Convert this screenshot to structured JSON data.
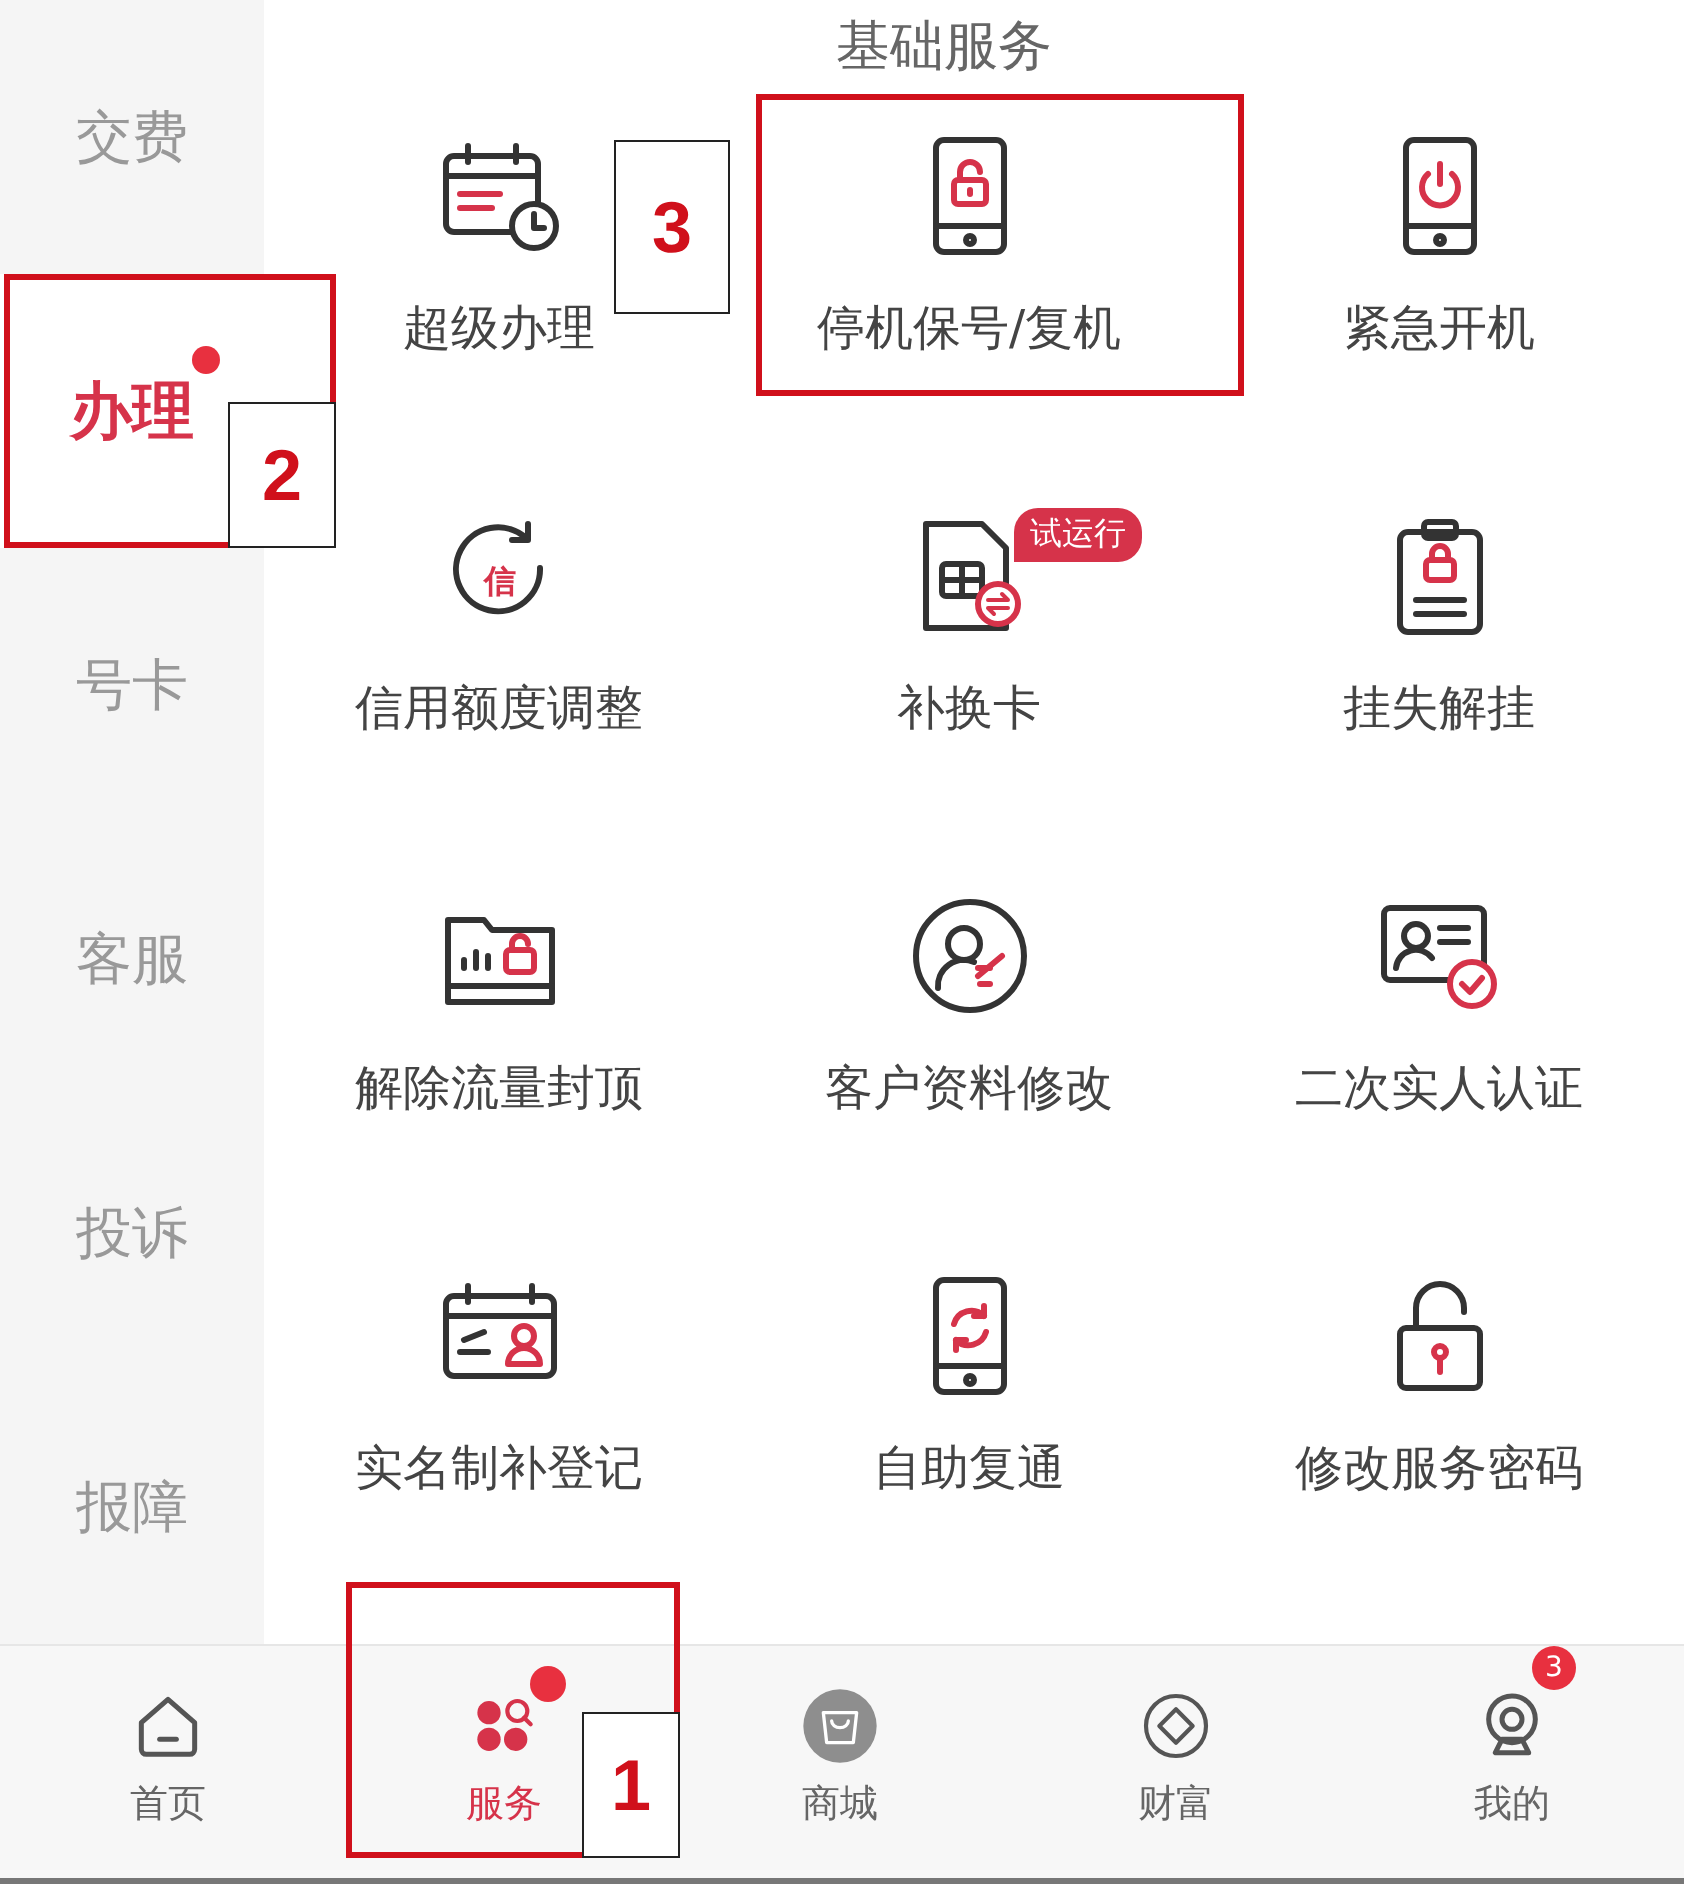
{
  "section_title": "基础服务",
  "sidebar": {
    "items": [
      {
        "label": "交费",
        "selected": false,
        "dot": false
      },
      {
        "label": "办理",
        "selected": true,
        "dot": true,
        "annotation": "2"
      },
      {
        "label": "号卡",
        "selected": false,
        "dot": false
      },
      {
        "label": "客服",
        "selected": false,
        "dot": false
      },
      {
        "label": "投诉",
        "selected": false,
        "dot": false
      },
      {
        "label": "报障",
        "selected": false,
        "dot": false
      }
    ]
  },
  "services": [
    {
      "label": "超级办理"
    },
    {
      "label": "停机保号/复机",
      "annotation": "3"
    },
    {
      "label": "紧急开机"
    },
    {
      "label": "信用额度调整",
      "icon_text": "信"
    },
    {
      "label": "补换卡",
      "badge": "试运行"
    },
    {
      "label": "挂失解挂"
    },
    {
      "label": "解除流量封顶"
    },
    {
      "label": "客户资料修改"
    },
    {
      "label": "二次实人认证"
    },
    {
      "label": "实名制补登记"
    },
    {
      "label": "自助复通"
    },
    {
      "label": "修改服务密码"
    }
  ],
  "tab_bar": {
    "tabs": [
      {
        "label": "首页",
        "selected": false,
        "dot": false
      },
      {
        "label": "服务",
        "selected": true,
        "dot": true,
        "annotation": "1"
      },
      {
        "label": "商城",
        "selected": false,
        "dot": false
      },
      {
        "label": "财富",
        "selected": false,
        "dot": false
      },
      {
        "label": "我的",
        "selected": false,
        "dot": false,
        "badge": "3"
      }
    ]
  }
}
